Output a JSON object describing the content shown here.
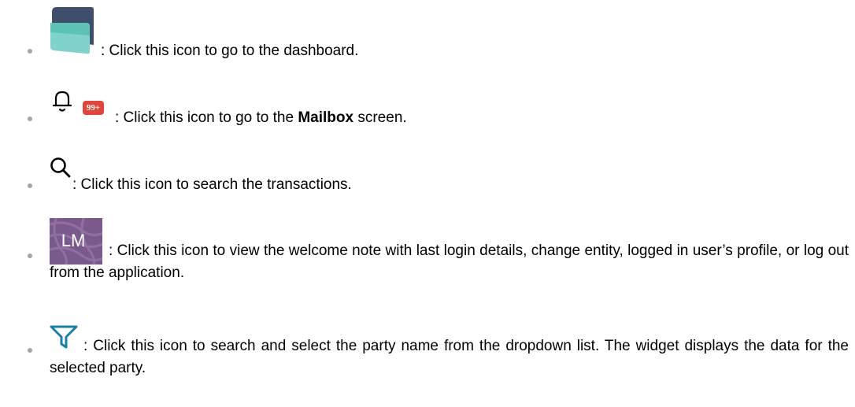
{
  "items": [
    {
      "icon": "dashboard-logo-icon",
      "text": ": Click this icon to go to the dashboard."
    },
    {
      "icon": "bell-icon",
      "badge": "99+",
      "text_before": ": Click this icon to go to the ",
      "text_bold": "Mailbox",
      "text_after": " screen."
    },
    {
      "icon": "search-icon",
      "text": ": Click this icon to search the transactions."
    },
    {
      "icon": "avatar-icon",
      "avatar_initials": "LM",
      "text": ": Click this icon to view the welcome note with last login details, change entity, logged in user’s profile, or log out from the application."
    },
    {
      "icon": "filter-icon",
      "text": ": Click this icon to search and select the party name from the dropdown list. The widget displays the data for the selected party."
    }
  ],
  "colors": {
    "badge": "#e0463a",
    "avatar": "#7a5a8c",
    "filter": "#1a7fa8",
    "logo_dark": "#3d4f6a",
    "logo_teal": "#5ec2b7",
    "bullet": "#a6a6a6"
  }
}
